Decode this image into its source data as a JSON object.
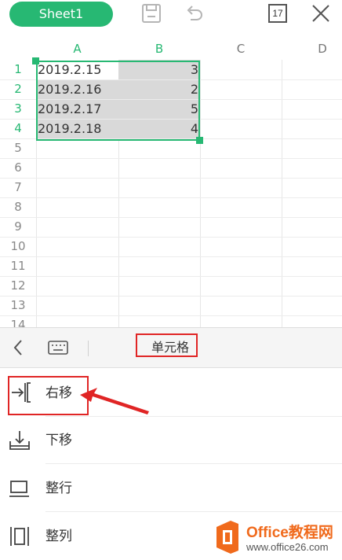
{
  "toolbar": {
    "sheet_tab": "Sheet1",
    "calendar_badge": "17"
  },
  "columns": [
    "A",
    "B",
    "C",
    "D"
  ],
  "rows": [
    {
      "num": "1",
      "a": "2019.2.15",
      "b": "3"
    },
    {
      "num": "2",
      "a": "2019.2.16",
      "b": "2"
    },
    {
      "num": "3",
      "a": "2019.2.17",
      "b": "5"
    },
    {
      "num": "4",
      "a": "2019.2.18",
      "b": "4"
    },
    {
      "num": "5"
    },
    {
      "num": "6"
    },
    {
      "num": "7"
    },
    {
      "num": "8"
    },
    {
      "num": "9"
    },
    {
      "num": "10"
    },
    {
      "num": "11"
    },
    {
      "num": "12"
    },
    {
      "num": "13"
    },
    {
      "num": "14"
    }
  ],
  "panel": {
    "title": "单元格"
  },
  "menu": [
    {
      "label": "右移"
    },
    {
      "label": "下移"
    },
    {
      "label": "整行"
    },
    {
      "label": "整列"
    }
  ],
  "watermark": {
    "name": "Office教程网",
    "url": "www.office26.com"
  },
  "colors": {
    "accent": "#27b873",
    "selection_fill": "#d9d9d9",
    "annotation_red": "#e02525",
    "logo_orange": "#f06a1c"
  }
}
